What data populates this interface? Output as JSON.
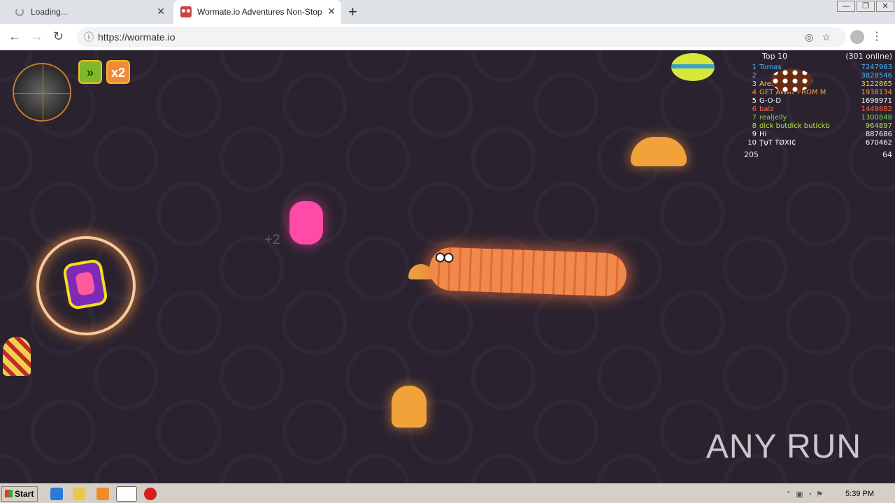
{
  "browser": {
    "tabs": [
      {
        "label": "Loading..."
      },
      {
        "label": "Wormate.io Adventures Non-Stop"
      }
    ],
    "url": "https://wormate.io"
  },
  "game": {
    "powerups": {
      "speed": "»",
      "multiplier": "x2"
    },
    "floating_text": "+2",
    "leaderboard": {
      "title": "Top 10",
      "online": "(301 online)",
      "entries": [
        {
          "rank": "1",
          "name": "Tomas",
          "score": "7247983",
          "color": "#4fb3ff"
        },
        {
          "rank": "2",
          "name": "",
          "score": "3828546",
          "color": "#4fb3ff"
        },
        {
          "rank": "3",
          "name": "Area 51",
          "score": "3122865",
          "color": "#ffd34a"
        },
        {
          "rank": "4",
          "name": "GET AWAY FROM M",
          "score": "1938134",
          "color": "#ff9a3c"
        },
        {
          "rank": "5",
          "name": "G-O-D",
          "score": "1698971",
          "color": "#ffffff"
        },
        {
          "rank": "6",
          "name": "balz",
          "score": "1449882",
          "color": "#ff6a4a"
        },
        {
          "rank": "7",
          "name": "realjelly",
          "score": "1300848",
          "color": "#7ed957"
        },
        {
          "rank": "8",
          "name": "dick butdick butickb",
          "score": "964897",
          "color": "#b8e04a"
        },
        {
          "rank": "9",
          "name": "Hi",
          "score": "887686",
          "color": "#ffffff"
        },
        {
          "rank": "10",
          "name": "ŢψŤ ŤØXĪ₵",
          "score": "670462",
          "color": "#ffffff"
        }
      ],
      "player_rank": "205",
      "player_score": "64"
    }
  },
  "watermark": "ANY RUN",
  "taskbar": {
    "start_label": "Start",
    "clock": "5:39 PM"
  }
}
